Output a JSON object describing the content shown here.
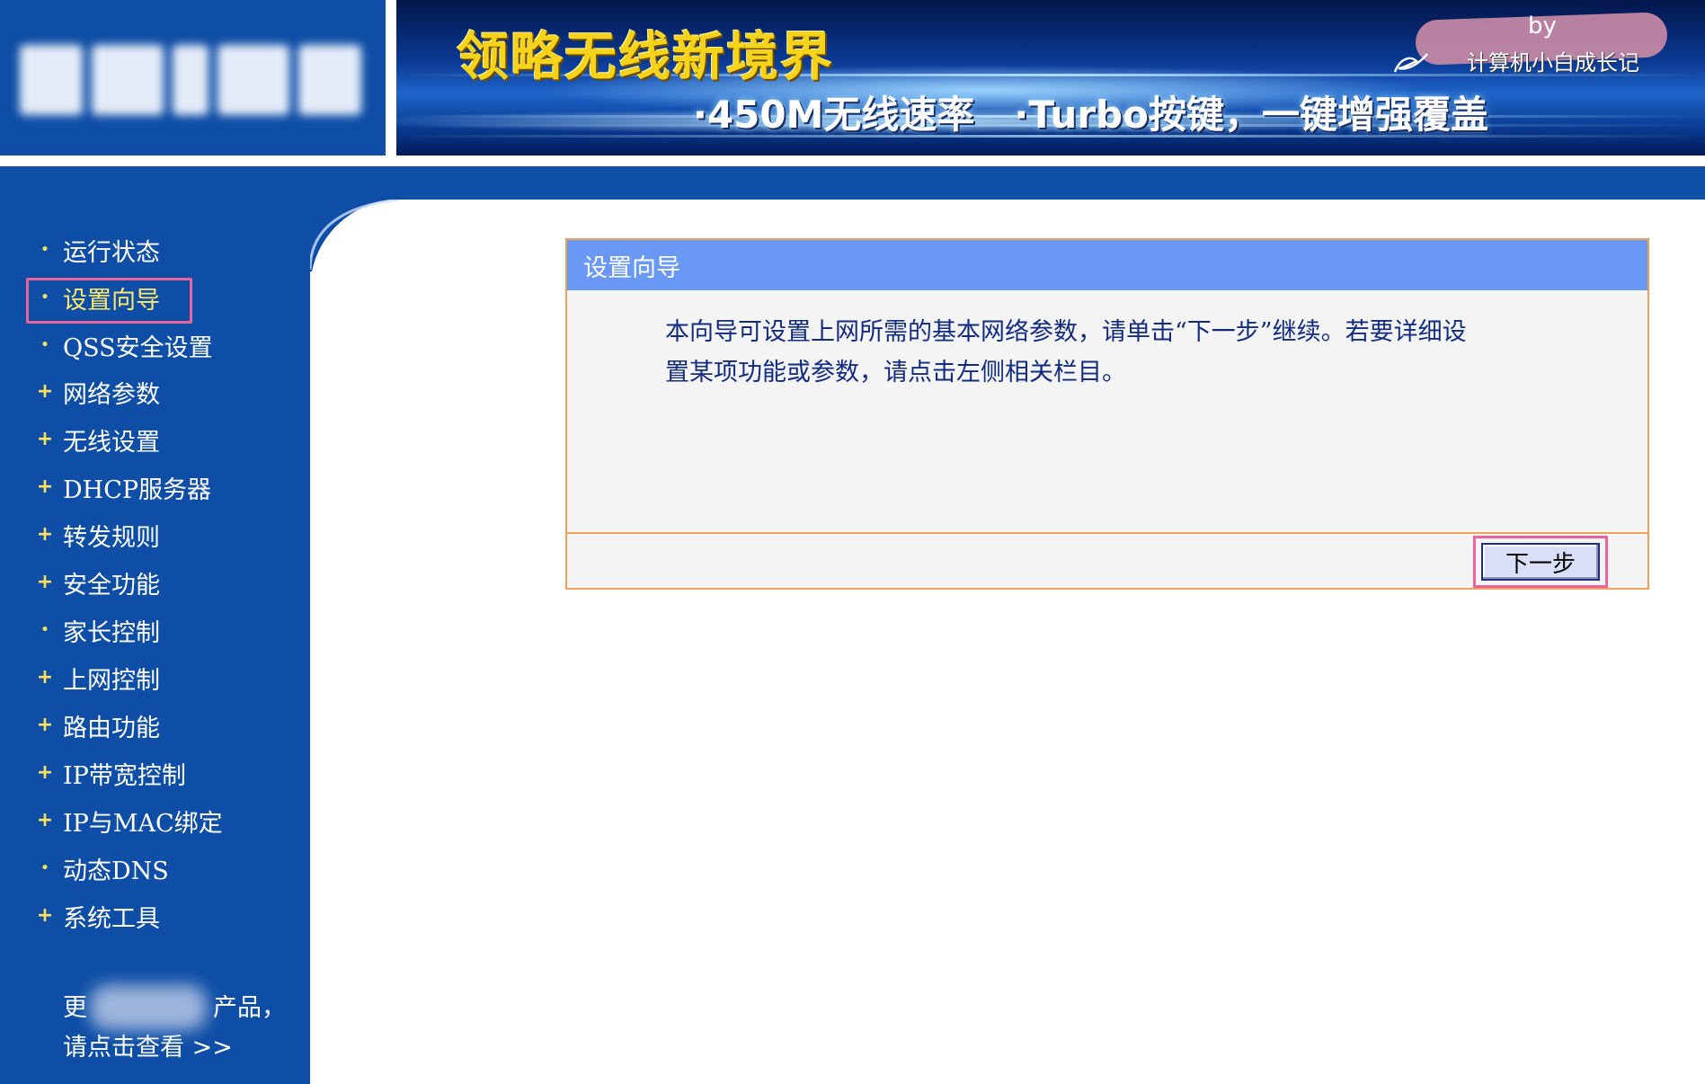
{
  "header": {
    "banner_title": "领略无线新境界",
    "banner_feature_1": "·450M无线速率",
    "banner_feature_2": "·Turbo按键，一键增强覆盖",
    "credit_by": "by",
    "credit_name": "计算机小白成长记"
  },
  "sidebar": {
    "items": [
      {
        "label": "运行状态",
        "bullet": "•"
      },
      {
        "label": "设置向导",
        "bullet": "•"
      },
      {
        "label": "QSS安全设置",
        "bullet": "•"
      },
      {
        "label": "网络参数",
        "bullet": "+"
      },
      {
        "label": "无线设置",
        "bullet": "+"
      },
      {
        "label": "DHCP服务器",
        "bullet": "+"
      },
      {
        "label": "转发规则",
        "bullet": "+"
      },
      {
        "label": "安全功能",
        "bullet": "+"
      },
      {
        "label": "家长控制",
        "bullet": "•"
      },
      {
        "label": "上网控制",
        "bullet": "+"
      },
      {
        "label": "路由功能",
        "bullet": "+"
      },
      {
        "label": "IP带宽控制",
        "bullet": "+"
      },
      {
        "label": "IP与MAC绑定",
        "bullet": "+"
      },
      {
        "label": "动态DNS",
        "bullet": "•"
      },
      {
        "label": "系统工具",
        "bullet": "+"
      }
    ],
    "active_item": "设置向导",
    "more_line1_start": "更",
    "more_line1_end": "产品，",
    "more_line2": "请点击查看 >>"
  },
  "wizard": {
    "title": "设置向导",
    "description_line1": "本向导可设置上网所需的基本网络参数，请单击“下一步”继续。若要详细设",
    "description_line2": "置某项功能或参数，请点击左侧相关栏目。",
    "next_button_label": "下一步"
  },
  "colors": {
    "nav_blue": "#0f4ea6",
    "panel_header": "#6a98f5",
    "panel_border": "#f0a25a",
    "highlight_frame": "#e8649a",
    "bullet_yellow": "#ffe15a"
  }
}
